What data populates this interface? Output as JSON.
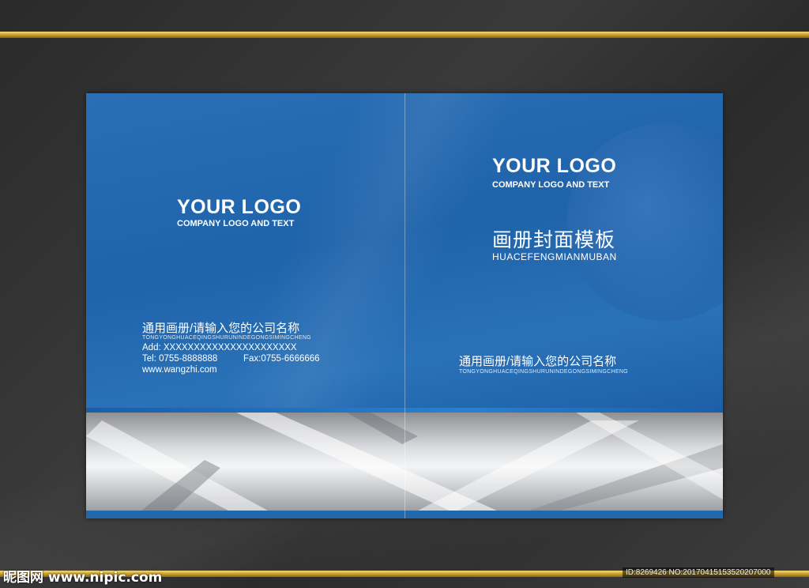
{
  "left_panel": {
    "logo": "YOUR LOGO",
    "logo_sub": "COMPANY LOGO AND TEXT",
    "company_cn": "通用画册/请输入您的公司名称",
    "company_pinyin": "TONGYONGHUACEQINGSHURUNINDEGONGSIMINGCHENG",
    "address": "Add: XXXXXXXXXXXXXXXXXXXXXX",
    "tel": "Tel: 0755-8888888",
    "fax": "Fax:0755-6666666",
    "website": "www.wangzhi.com"
  },
  "right_panel": {
    "logo": "YOUR LOGO",
    "logo_sub": "COMPANY LOGO AND TEXT",
    "title_cn": "画册封面模板",
    "title_pinyin": "HUACEFENGMIANMUBAN",
    "company_cn": "通用画册/请输入您的公司名称",
    "company_pinyin": "TONGYONGHUACEQINGSHURUNINDEGONGSIMINGCHENG"
  },
  "watermark": {
    "site": "昵图网 www.nipic.com",
    "id": "ID:8269426 NO:20170415153520207000"
  },
  "colors": {
    "cover_blue": "#2367ad",
    "gold": "#c79a2a",
    "background": "#333333"
  }
}
